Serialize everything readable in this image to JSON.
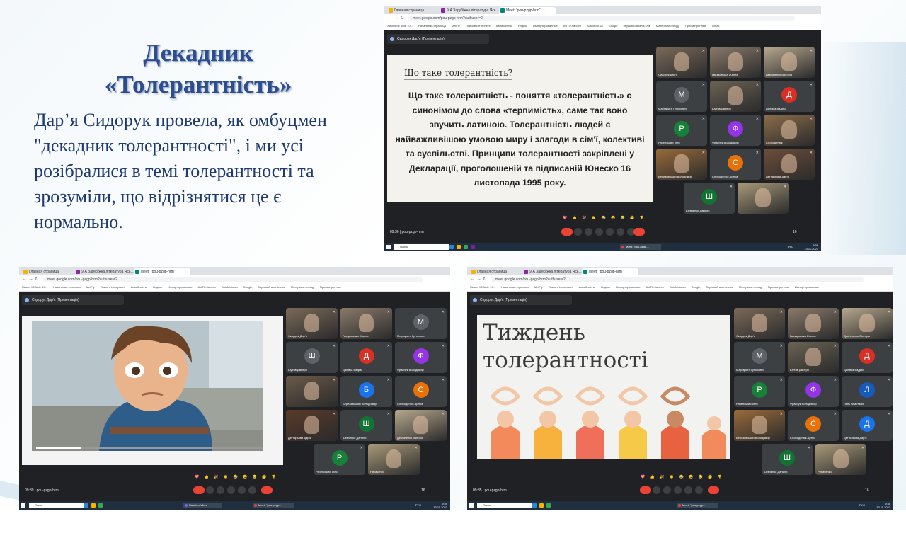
{
  "slide": {
    "title": "Декадник «Толерантність»",
    "body": "Дар’я Сидорук провела, як омбуцмен \"декадник толерантності\", і ми усі розібралися в темі толерантності та зрозуміли, що відрізнятися це є нормально."
  },
  "shot1": {
    "tabs": [
      "Главная страница",
      "9-А Зарубіжна література Ясь...",
      "Meet: \"pou-pzgp-hrm\""
    ],
    "url": "meet.google.com/pou-pzgp-hrm?authuser=2",
    "bookmarks": [
      "Xiaomi Mi Note 10...",
      "Начальная страница",
      "MetFly",
      "Поиск в Интернете",
      "Авиабилеты",
      "Яндекс",
      "Импортированные",
      "AUTO.ria.com",
      "AutoMoto.ua",
      "Google",
      "Звуковий аналіз слів",
      "Матеріали огляду",
      "Просмотренные",
      "Gmail"
    ],
    "presenter": "Сидорук Дар'я (Презентація)",
    "slide_question": "Що таке толерантність?",
    "slide_text": "Що таке толерантність - поняття «толерантність» є синонімом до слова «терпимість», саме так воно звучить латиною. Толерантність людей є найважливішою умовою миру і злагоди в сім'ї, колективі та суспільстві. Принципи толерантності закріплені у Декларації, проголошеній та підписаній Юнеско 16 листопада 1995 року.",
    "participants": [
      {
        "name": "Сидорук Дар'я",
        "letter": "",
        "color": "#7b6a5a"
      },
      {
        "name": "Гвоздовська Жанна",
        "letter": "",
        "color": "#8a7a6a"
      },
      {
        "name": "Дем'яненко Вікторія",
        "letter": "",
        "color": "#b7a88e"
      },
      {
        "name": "Маргарита Гуторович",
        "letter": "М",
        "color": "#5f6368"
      },
      {
        "name": "Шутов Дмитро",
        "letter": "",
        "color": "#6b6354"
      },
      {
        "name": "Далівка Вадим",
        "letter": "Д",
        "color": "#d93025"
      },
      {
        "name": "Раченський Ілля",
        "letter": "Р",
        "color": "#188038"
      },
      {
        "name": "Франчук Володимир",
        "letter": "Ф",
        "color": "#9334e6"
      },
      {
        "name": "Слободенюк",
        "letter": "",
        "color": "#8b6d4a"
      },
      {
        "name": "Березовський Володимир",
        "letter": "",
        "color": "#9a6b3a"
      },
      {
        "name": "Слободенюк Артем",
        "letter": "С",
        "color": "#e8710a"
      },
      {
        "name": "Дегтярьова Дар'я",
        "letter": "",
        "color": "#6e4e3a"
      },
      {
        "name": "Шевченко Данило",
        "letter": "Ш",
        "color": "#137333"
      },
      {
        "name": "",
        "letter": "",
        "color": "#a99a7a"
      }
    ],
    "reactions": "💖 👍 🎉 👏 😂 😮 😢 🤔 👎",
    "time": "09:36",
    "meeting_code": "pou-pzgp-hrm",
    "people_count": "16",
    "taskbar_search": "Поиск",
    "taskbar_app": "Meet: \"pou-pzgp...",
    "taskbar_lang": "РУС",
    "clock_time": "9:36",
    "clock_date": "13.11.2023"
  },
  "shot2": {
    "tabs": [
      "Главная страница",
      "9-А Зарубіжна література Ясь...",
      "Meet: \"pou-pzgp-hrm\""
    ],
    "url": "meet.google.com/pou-pzgp-hrm?authuser=2",
    "bookmarks": [
      "Xiaomi Mi Note 10...",
      "Начальная страница",
      "MetFly",
      "Поиск в Интернете",
      "Авиабилеты",
      "Яндекс",
      "Импортированные",
      "AUTO.ria.com",
      "AutoMoto.ua",
      "Google",
      "Звуковий аналіз слів",
      "Матеріали огляду",
      "Просмотренные"
    ],
    "presenter": "Сидорук Дар'я (Презентація)",
    "participants": [
      {
        "name": "Сидорук Дар'я",
        "letter": "",
        "color": "#7b6a5a"
      },
      {
        "name": "Гвоздовська Жанна",
        "letter": "",
        "color": "#8a7a6a"
      },
      {
        "name": "Маргарита Гуторович",
        "letter": "М",
        "color": "#5f6368"
      },
      {
        "name": "Шутов Дмитро",
        "letter": "Ш",
        "color": "#5f6368"
      },
      {
        "name": "Далівка Вадим",
        "letter": "Д",
        "color": "#d93025"
      },
      {
        "name": "Франчук Володимир",
        "letter": "Ф",
        "color": "#9334e6"
      },
      {
        "name": "",
        "letter": "",
        "color": "#6b5a4a"
      },
      {
        "name": "Березовський Володимир",
        "letter": "Б",
        "color": "#1a73e8"
      },
      {
        "name": "Слободенюк Артем",
        "letter": "С",
        "color": "#e8710a"
      },
      {
        "name": "Дегтярьова Дар'я",
        "letter": "",
        "color": "#5a3a2a"
      },
      {
        "name": "Шевченко Данило",
        "letter": "Ш",
        "color": "#137333"
      },
      {
        "name": "Дем'яненко Вікторія",
        "letter": "",
        "color": "#b7a88e"
      },
      {
        "name": "Раченський Ілля",
        "letter": "Р",
        "color": "#188038"
      },
      {
        "name": "Рибаченко",
        "letter": "",
        "color": "#a99a7a"
      }
    ],
    "reactions": "💖 👍 🎉 👏 😂 😮 😢 🤔 👎",
    "time": "09:39",
    "meeting_code": "pou-pzgp-hrm",
    "people_count": "16",
    "taskbar_search": "Поиск",
    "taskbar_app": "Meet: \"pou-pzgp...",
    "taskbar_app2": "Rakuten Viber",
    "taskbar_lang": "РУС",
    "clock_time": "9:39",
    "clock_date": "13.11.2023"
  },
  "shot3": {
    "tabs": [
      "Главная страница",
      "9-А Зарубіжна література Ясь...",
      "Meet: \"pou-pzgp-hrm\""
    ],
    "url": "meet.google.com/pou-pzgp-hrm?authuser=2",
    "bookmarks": [
      "Xiaomi Mi Note 10...",
      "Начальная страница",
      "MetFly",
      "Поиск в Интернете",
      "Авиабилеты",
      "Яндекс",
      "Импортированные",
      "AUTO.ria.com",
      "AutoMoto.ua",
      "Google",
      "Звуковий аналіз слів",
      "Матеріали огляду",
      "Просмотренные",
      "Импортированные"
    ],
    "presenter": "Сидорук Дар'я (Презентація)",
    "slide_title_line1": "Тиждень",
    "slide_title_line2": "толерантності",
    "participants": [
      {
        "name": "Сидорук Дар'я",
        "letter": "",
        "color": "#7b6a5a"
      },
      {
        "name": "Гвоздовська Жанна",
        "letter": "",
        "color": "#8a7a6a"
      },
      {
        "name": "Дем'яненко Вікторія",
        "letter": "",
        "color": "#b7a88e"
      },
      {
        "name": "Маргарита Гуторович",
        "letter": "М",
        "color": "#5f6368"
      },
      {
        "name": "Шутов Дмитро",
        "letter": "",
        "color": "#6b6354"
      },
      {
        "name": "Далівка Вадим",
        "letter": "Д",
        "color": "#d93025"
      },
      {
        "name": "Раченський Ілля",
        "letter": "Р",
        "color": "#188038"
      },
      {
        "name": "Франчук Володимир",
        "letter": "Ф",
        "color": "#9334e6"
      },
      {
        "name": "Лень Анастасія",
        "letter": "Л",
        "color": "#185abc"
      },
      {
        "name": "Березовський Володимир",
        "letter": "",
        "color": "#9a6b3a"
      },
      {
        "name": "Слободенюк Артем",
        "letter": "С",
        "color": "#e8710a"
      },
      {
        "name": "Дегтярьова Дар'я",
        "letter": "Д",
        "color": "#1a73e8"
      },
      {
        "name": "Шевченко Данило",
        "letter": "Ш",
        "color": "#137333"
      },
      {
        "name": "Рибаченко",
        "letter": "",
        "color": "#a99a7a"
      }
    ],
    "reactions": "💖 👍 🎉 👏 😂 😮 😢 🤔 👎",
    "time": "09:35",
    "meeting_code": "pou-pzgp-hrm",
    "people_count": "16",
    "taskbar_search": "Поиск",
    "taskbar_app": "Meet: \"pou-pzgp...",
    "taskbar_lang": "РУС",
    "clock_time": "9:35",
    "clock_date": "13.11.2023"
  }
}
